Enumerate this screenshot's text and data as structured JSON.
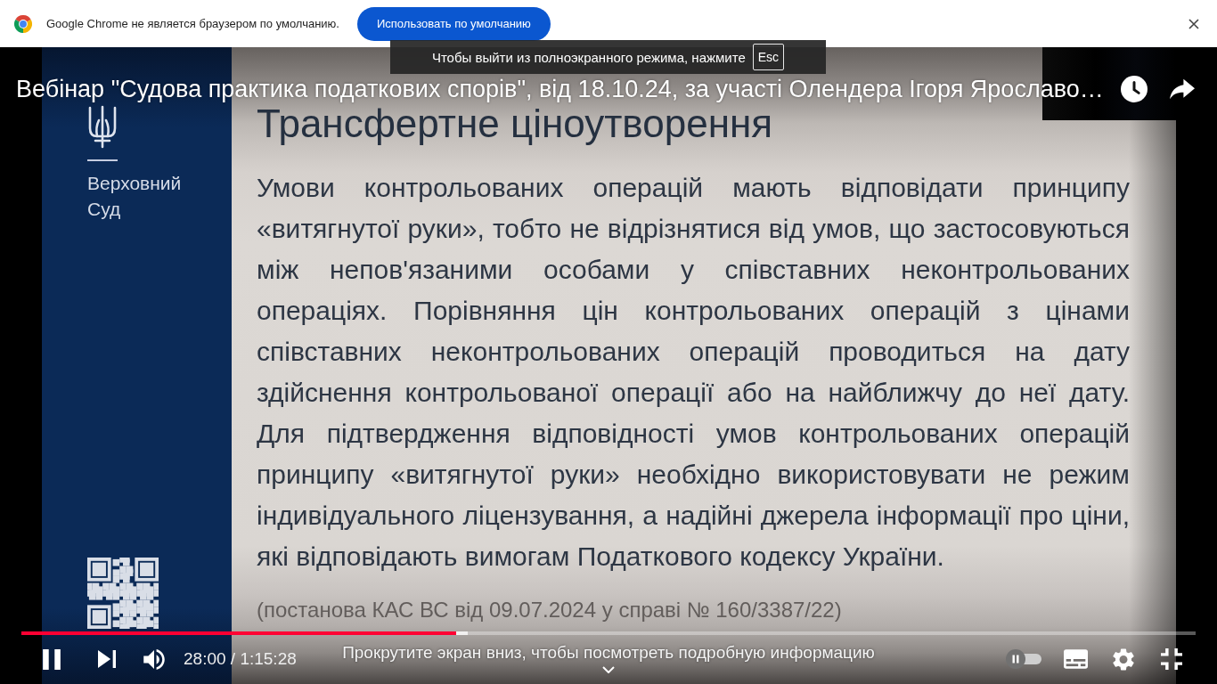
{
  "infobar": {
    "message": "Google Chrome не является браузером по умолчанию.",
    "button": "Использовать по умолчанию"
  },
  "fullscreen_hint": {
    "message": "Чтобы выйти из полноэкранного режима, нажмите",
    "key": "Esc"
  },
  "video": {
    "title": "Вебінар \"Судова практика податкових спорів\", від 18.10.24, за участі Олендера Ігоря Ярославо…"
  },
  "slide": {
    "court_name": "Верховний Суд",
    "heading": "Трансфертне ціноутворення",
    "body": "Умови контрольованих операцій мають відповідати принципу «витягнутої руки», тобто не відрізнятися від умов, що застосовуються між непов'язаними особами у співставних неконтрольованих операціях. Порівняння цін контрольованих операцій з цінами співставних неконтрольованих операцій проводиться на дату здійснення контрольованої операції або на найближчу до неї дату. Для підтвердження відповідності умов контрольованих операцій принципу «витягнутої руки» необхідно використовувати не режим індивідуального ліцензування, а надійні джерела інформації про ціни, які відповідають вимогам Податкового кодексу України.",
    "citation": "(постанова КАС ВС від 09.07.2024 у справі № 160/3387/22)"
  },
  "player": {
    "playing": true,
    "progress": {
      "level": 0.37
    },
    "buffer": {
      "level": 0.38
    },
    "time": "28:00 / 1:15:28",
    "scroll_hint": "Прокрутите экран вниз, чтобы посмотреть подробную информацию",
    "autoplay": {
      "on": false
    }
  }
}
